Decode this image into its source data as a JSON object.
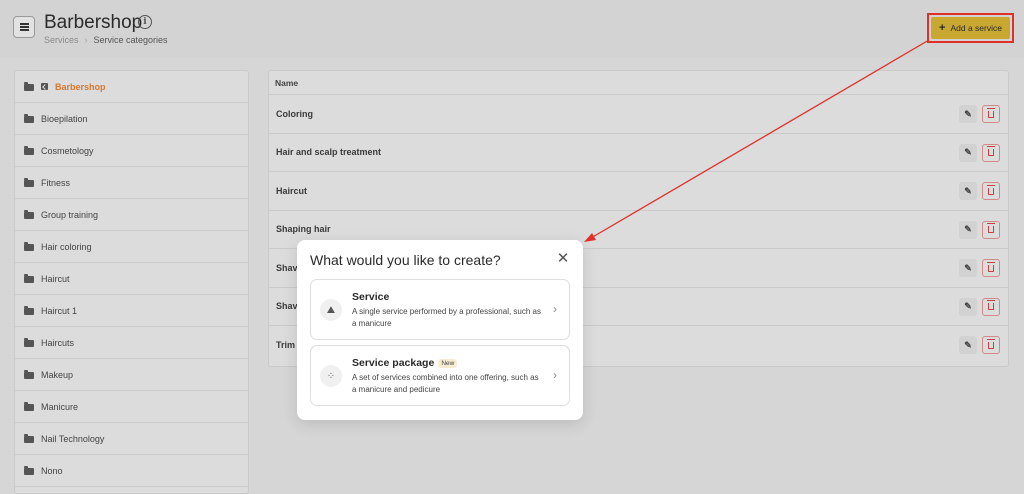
{
  "header": {
    "title": "Barbershop",
    "breadcrumb": [
      "Services",
      "Service categories"
    ],
    "add_button_label": "Add a service",
    "add_button_icon": "plus-icon"
  },
  "sidebar": {
    "items": [
      {
        "label": "Barbershop",
        "active": true
      },
      {
        "label": "Bioepilation"
      },
      {
        "label": "Cosmetology"
      },
      {
        "label": "Fitness"
      },
      {
        "label": "Group training"
      },
      {
        "label": "Hair coloring"
      },
      {
        "label": "Haircut"
      },
      {
        "label": "Haircut 1"
      },
      {
        "label": "Haircuts"
      },
      {
        "label": "Makeup"
      },
      {
        "label": "Manicure"
      },
      {
        "label": "Nail Technology"
      },
      {
        "label": "Nono"
      }
    ]
  },
  "table": {
    "header": "Name",
    "rows": [
      {
        "name": "Coloring"
      },
      {
        "name": "Hair and scalp treatment"
      },
      {
        "name": "Haircut"
      },
      {
        "name": "Shaping hair"
      },
      {
        "name": "Shav"
      },
      {
        "name": "Shav"
      },
      {
        "name": "Trim"
      }
    ]
  },
  "modal": {
    "title": "What would you like to create?",
    "options": [
      {
        "title": "Service",
        "description": "A single service performed by a professional, such as a manicure",
        "icon": "service-bell-icon"
      },
      {
        "title": "Service package",
        "badge": "New",
        "description": "A set of services combined into one offering, such as a manicure and pedicure",
        "icon": "package-grid-icon"
      }
    ]
  },
  "colors": {
    "accent": "#d8772e",
    "add_button": "#c9a832",
    "annotation": "#e0302a"
  }
}
